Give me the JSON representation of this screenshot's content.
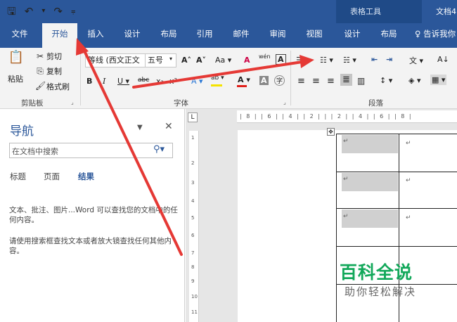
{
  "titlebar": {
    "qat": [
      {
        "name": "save-icon",
        "glyph": "🖫"
      },
      {
        "name": "undo-icon",
        "glyph": "↶"
      },
      {
        "name": "undo-dropdown-icon",
        "glyph": "▾"
      },
      {
        "name": "redo-icon",
        "glyph": "↷"
      },
      {
        "name": "customize-qat-icon",
        "glyph": "⩦"
      }
    ],
    "context_title": "表格工具",
    "document_title": "文档4"
  },
  "tabs": {
    "file": "文件",
    "home": "开始",
    "insert": "插入",
    "design": "设计",
    "layout": "布局",
    "references": "引用",
    "mailings": "邮件",
    "review": "审阅",
    "view": "视图",
    "table_design": "设计",
    "table_layout": "布局",
    "tell_me": "♀ 告诉我你"
  },
  "ribbon": {
    "clipboard": {
      "paste": "粘贴",
      "cut": "剪切",
      "copy": "复制",
      "format_painter": "格式刷",
      "label": "剪贴板"
    },
    "font": {
      "font_name": "等线 (西文正文",
      "font_size": "五号",
      "label": "字体",
      "row1": [
        "A˄",
        "A˅",
        "Aa ▾",
        "A",
        "wén",
        "A"
      ],
      "row2": [
        "B",
        "I",
        "U ▾",
        "abc",
        "x₂",
        "x²",
        "A ▾",
        "ab ▾",
        "A ▾",
        "A",
        "字"
      ]
    },
    "paragraph": {
      "label": "段落",
      "row1": [
        "☰ ▾",
        "☷ ▾",
        "☵ ▾",
        "⇤",
        "⇥",
        "文 ▾",
        "A↓"
      ],
      "row2": [
        "≡",
        "≡",
        "≡",
        "≣",
        "▥",
        "↕ ▾",
        "◈ ▾",
        "▦ ▾"
      ]
    },
    "colors": {
      "accent": "#2b579a",
      "font_color_bar": "#e0201a",
      "highlight_bar": "#f5e300"
    }
  },
  "navigation": {
    "title": "导航",
    "search_placeholder": "在文档中搜索",
    "tabs": {
      "headings": "标题",
      "pages": "页面",
      "results": "结果"
    },
    "help1": "文本、批注、图片...Word 可以查找您的文档中的任何内容。",
    "help2": "请使用搜索框查找文本或者放大镜查找任何其他内容。"
  },
  "document": {
    "ruler_ticks": "| 8 |  | 6 |  | 4 |  | 2 |  |  | 2 |  | 4 |  | 6 |  | 8 |",
    "ruler_corner": "L",
    "vertical_ruler_numbers": [
      "1",
      "2",
      "3",
      "4",
      "5",
      "6",
      "7",
      "8",
      "9",
      "10",
      "11"
    ],
    "paragraph_mark": "↵",
    "move_handle": "✥"
  },
  "watermark": {
    "title": "百科全说",
    "subtitle": "助你轻松解决",
    "color": "#12a85a"
  }
}
